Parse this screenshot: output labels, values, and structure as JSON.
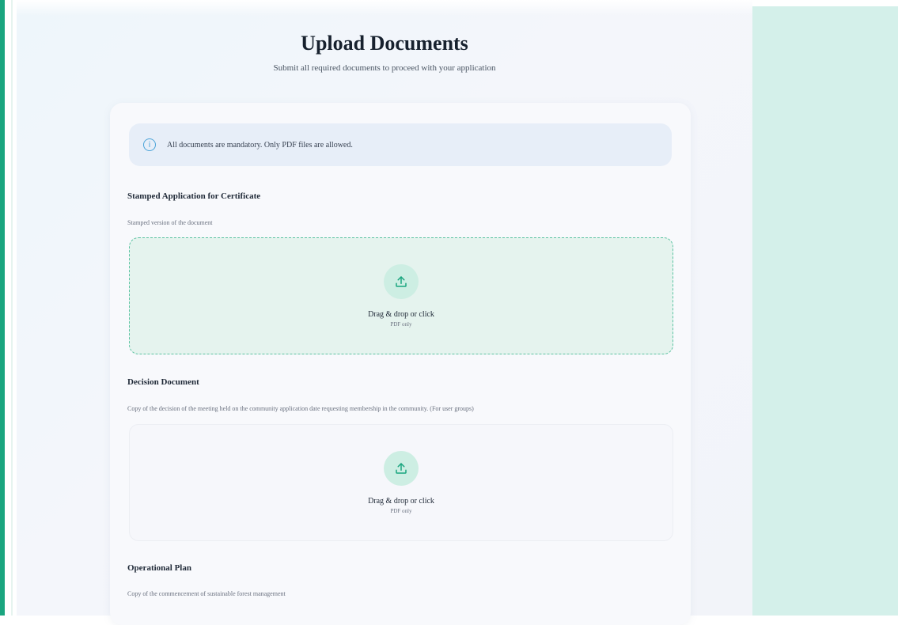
{
  "header": {
    "title": "Upload Documents",
    "subtitle": "Submit all required documents to proceed with your application"
  },
  "notice": {
    "text": "All documents are mandatory. Only PDF files are allowed.",
    "icon": "info-icon"
  },
  "documents": [
    {
      "title": "Stamped Application for Certificate",
      "description": "Stamped version of the document",
      "dropzone": {
        "label": "Drag & drop or click",
        "sub": "PDF only",
        "state": "active"
      }
    },
    {
      "title": "Decision Document",
      "description": "Copy of the decision of the meeting held on the community application date requesting membership in the community. (For user groups)",
      "dropzone": {
        "label": "Drag & drop or click",
        "sub": "PDF only",
        "state": "idle"
      }
    },
    {
      "title": "Operational Plan",
      "description": "Copy of the commencement of sustainable forest management"
    }
  ],
  "colors": {
    "accent": "#1aa57f",
    "dropzone_border": "#5cc3a2",
    "side_panel": "#d4f0ea",
    "info": "#4aa3d8"
  }
}
